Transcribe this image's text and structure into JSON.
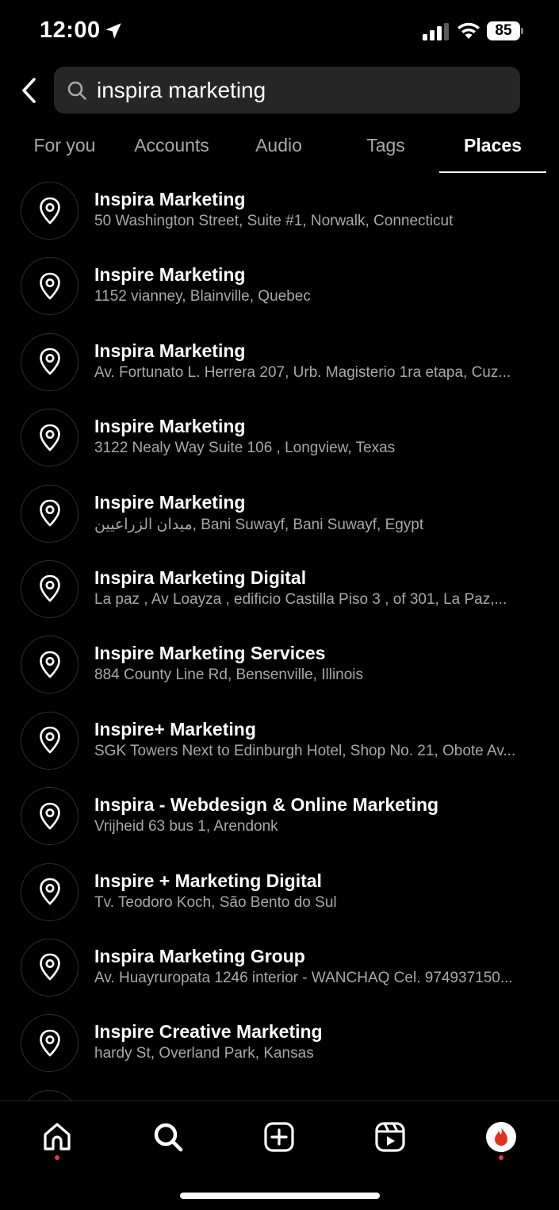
{
  "status_bar": {
    "time": "12:00",
    "battery": "85",
    "icons": [
      "location-arrow-icon",
      "cellular-signal-icon",
      "wifi-icon",
      "battery-icon"
    ]
  },
  "search": {
    "query": "inspira marketing",
    "icons": [
      "back-chevron-icon",
      "search-icon"
    ]
  },
  "tabs": [
    {
      "label": "For you",
      "active": false
    },
    {
      "label": "Accounts",
      "active": false
    },
    {
      "label": "Audio",
      "active": false
    },
    {
      "label": "Tags",
      "active": false
    },
    {
      "label": "Places",
      "active": true
    }
  ],
  "results": [
    {
      "name": "Inspira Marketing",
      "address": "50 Washington Street, Suite #1, Norwalk, Connecticut"
    },
    {
      "name": "Inspire Marketing",
      "address": "1152 vianney, Blainville, Quebec"
    },
    {
      "name": "Inspira Marketing",
      "address": "Av. Fortunato L. Herrera 207, Urb. Magisterio 1ra etapa, Cuz..."
    },
    {
      "name": "Inspire Marketing",
      "address": "3122 Nealy Way Suite 106 , Longview, Texas"
    },
    {
      "name": "Inspire Marketing",
      "address": "ميدان الزراعيين, Bani Suwayf, Bani Suwayf, Egypt"
    },
    {
      "name": "Inspira Marketing Digital",
      "address": "La paz , Av Loayza , edificio Castilla Piso 3 , of 301, La Paz,..."
    },
    {
      "name": "Inspire Marketing Services",
      "address": "884 County Line Rd, Bensenville, Illinois"
    },
    {
      "name": "Inspire+ Marketing",
      "address": "SGK Towers Next to Edinburgh Hotel, Shop No. 21, Obote Av..."
    },
    {
      "name": "Inspira - Webdesign & Online Marketing",
      "address": "Vrijheid 63 bus 1, Arendonk"
    },
    {
      "name": "Inspire + Marketing Digital",
      "address": "Tv. Teodoro Koch, São Bento do Sul"
    },
    {
      "name": "Inspira Marketing Group",
      "address": "Av. Huayruropata 1246 interior - WANCHAQ Cel. 974937150..."
    },
    {
      "name": "Inspire Creative Marketing",
      "address": "hardy St, Overland Park, Kansas"
    },
    {
      "name": "",
      "address": ""
    }
  ],
  "bottom_nav": {
    "items": [
      "home-icon",
      "search-icon",
      "create-icon",
      "reels-icon",
      "profile-avatar"
    ],
    "notification_color": "#ff3040"
  },
  "colors": {
    "background": "#000000",
    "search_field": "#262626",
    "secondary_text": "#a8a8a8"
  }
}
